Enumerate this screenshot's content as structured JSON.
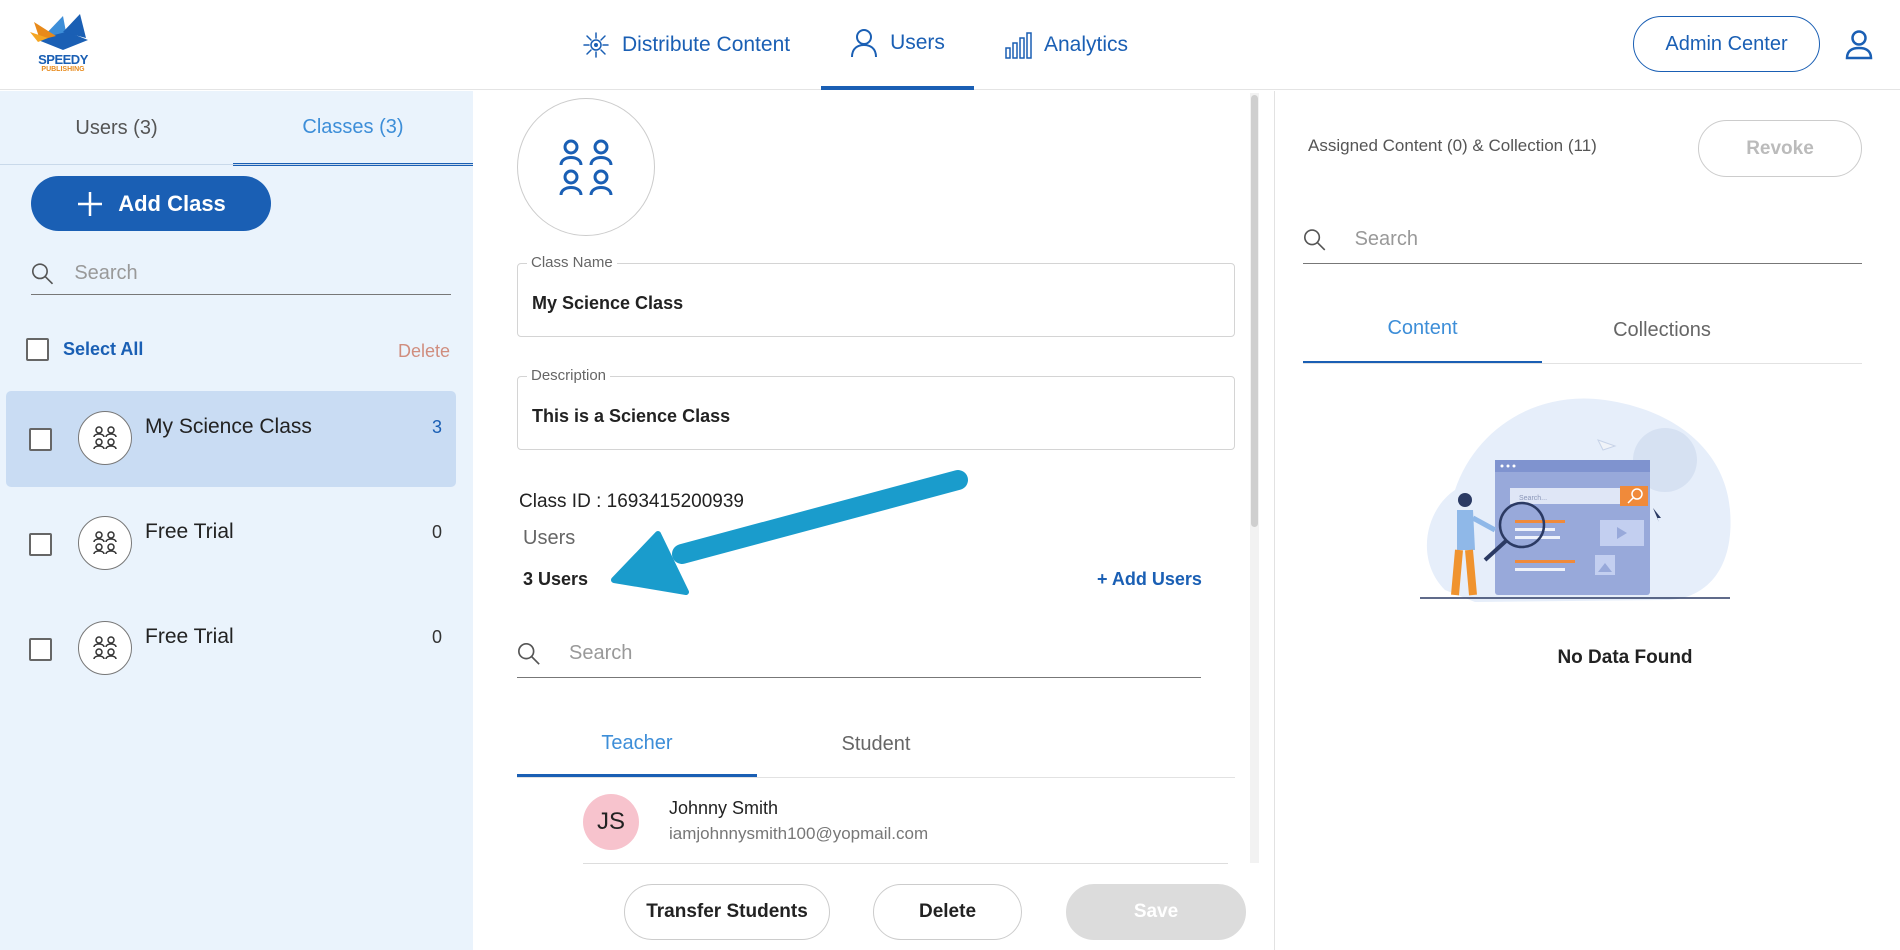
{
  "header": {
    "logo": {
      "line1": "SPEEDY",
      "line2": "PUBLISHING"
    },
    "nav": [
      {
        "label": "Distribute Content",
        "icon": "distribute-icon"
      },
      {
        "label": "Users",
        "icon": "user-icon",
        "active": true
      },
      {
        "label": "Analytics",
        "icon": "analytics-icon"
      }
    ],
    "admin_center_label": "Admin Center",
    "profile_icon": "profile-icon"
  },
  "left_panel": {
    "tabs": [
      {
        "label": "Users (3)"
      },
      {
        "label": "Classes (3)",
        "active": true
      }
    ],
    "add_class_label": "Add Class",
    "search_placeholder": "Search",
    "select_all_label": "Select All",
    "delete_label": "Delete",
    "classes": [
      {
        "name": "My Science Class",
        "count": "3",
        "selected": true
      },
      {
        "name": "Free Trial",
        "count": "0"
      },
      {
        "name": "Free Trial",
        "count": "0"
      }
    ]
  },
  "class_detail": {
    "class_name_label": "Class Name",
    "class_name_value": "My Science Class",
    "description_label": "Description",
    "description_value": "This is a Science Class",
    "class_id_text": "Class ID : 1693415200939",
    "users_label": "Users",
    "users_count": "3 Users",
    "add_users_label": "+ Add Users",
    "search_placeholder": "Search",
    "tabs": [
      {
        "label": "Teacher",
        "active": true
      },
      {
        "label": "Student"
      }
    ],
    "users": [
      {
        "initials": "JS",
        "name": "Johnny Smith",
        "email": "iamjohnnysmith100@yopmail.com"
      }
    ],
    "buttons": {
      "transfer": "Transfer Students",
      "delete": "Delete",
      "save": "Save"
    }
  },
  "assigned_panel": {
    "title": "Assigned Content (0) & Collection (11)",
    "revoke_label": "Revoke",
    "search_placeholder": "Search",
    "tabs": [
      {
        "label": "Content",
        "active": true
      },
      {
        "label": "Collections"
      }
    ],
    "illustration_search_text": "Search...",
    "empty_text": "No Data Found"
  },
  "colors": {
    "primary": "#1a5fb4",
    "accent": "#3d8ed8",
    "left_bg": "#eaf3fc",
    "selected_bg": "#c9dcf3",
    "arrow": "#1a9ccc"
  }
}
